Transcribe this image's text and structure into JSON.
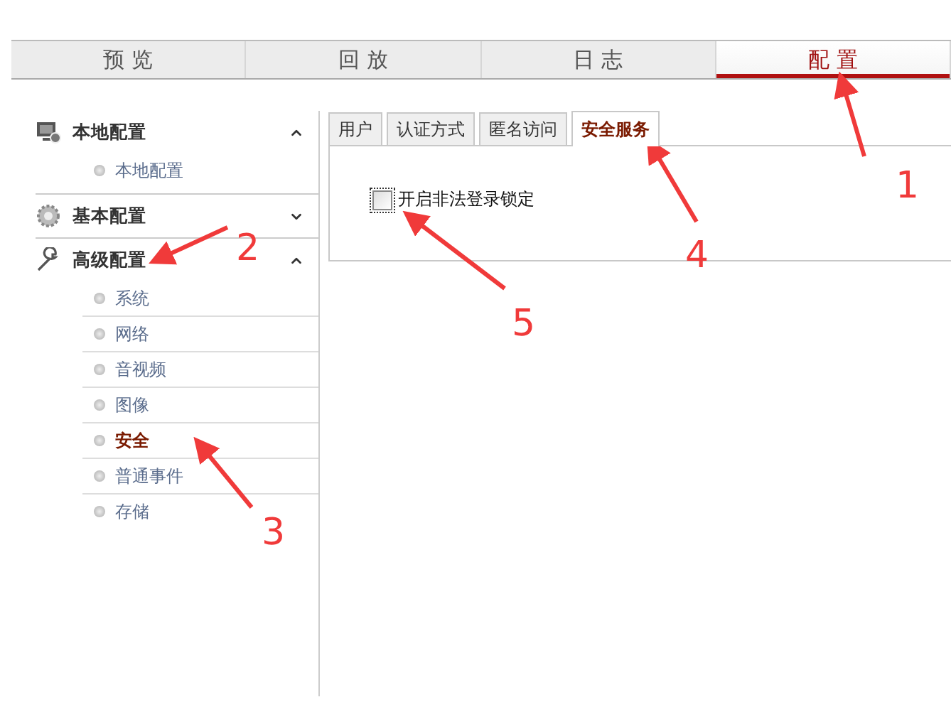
{
  "nav_tabs": [
    {
      "label": "预 览",
      "selected": false
    },
    {
      "label": "回 放",
      "selected": false
    },
    {
      "label": "日 志",
      "selected": false
    },
    {
      "label": "配 置",
      "selected": true
    }
  ],
  "sidebar": {
    "groups": [
      {
        "title": "本地配置",
        "expanded": true,
        "items": [
          {
            "label": "本地配置",
            "selected": false
          }
        ]
      },
      {
        "title": "基本配置",
        "expanded": false
      },
      {
        "title": "高级配置",
        "expanded": true,
        "items": [
          {
            "label": "系统",
            "selected": false
          },
          {
            "label": "网络",
            "selected": false
          },
          {
            "label": "音视频",
            "selected": false
          },
          {
            "label": "图像",
            "selected": false
          },
          {
            "label": "安全",
            "selected": true
          },
          {
            "label": "普通事件",
            "selected": false
          },
          {
            "label": "存储",
            "selected": false
          }
        ]
      }
    ]
  },
  "content_tabs": [
    {
      "label": "用户",
      "selected": false
    },
    {
      "label": "认证方式",
      "selected": false
    },
    {
      "label": "匿名访问",
      "selected": false
    },
    {
      "label": "安全服务",
      "selected": true
    }
  ],
  "option": {
    "label": "开启非法登录锁定",
    "checked": false
  },
  "annotations": [
    {
      "label": "1"
    },
    {
      "label": "2"
    },
    {
      "label": "3"
    },
    {
      "label": "4"
    },
    {
      "label": "5"
    }
  ]
}
